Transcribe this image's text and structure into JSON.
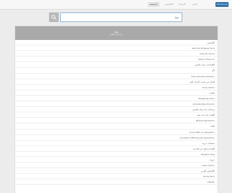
{
  "nav": {
    "brand": "ShinKoong",
    "items": [
      "القاموس",
      "الترجمة",
      "معاني",
      "الرئيسية"
    ]
  },
  "search": {
    "value": "روح",
    "button_icon": "search-icon"
  },
  "card": {
    "title": "روح",
    "subtitle": "مرادفات الكلمة",
    "items": [
      "القاموس",
      "Get Out Wrapper Kind",
      "Ireel Fin Doors",
      "Seterr Dhianorn",
      "ألفاظ ذات صلة بالمعنى",
      "لاق",
      "Care Outside Direction",
      "أفعال غير متعدية لأحرف الجر",
      "Gone Admin",
      "ثلاثيات",
      "Midgarder Ferni",
      "Outside Raw Director",
      "مرادفات ذات صلة بالتعبير",
      "ألفاظ عامة ذات صلة",
      "Mobile Operations",
      "ثقافة",
      "Come With an Operation",
      "Life Parte Office Roots Operations",
      "مشتقات عربية",
      "ألفاظ متداولة في الحديث",
      "Pangwe Case",
      "حروف",
      "Gane Admin",
      "القاموس العربي",
      "Mode Ferni",
      "ملاحظات"
    ]
  },
  "colors": {
    "header_bg": "#a9a9a9",
    "brand_bg": "#2c6fa8",
    "page_bg": "#ececec",
    "input_border": "#8cb4d8"
  }
}
